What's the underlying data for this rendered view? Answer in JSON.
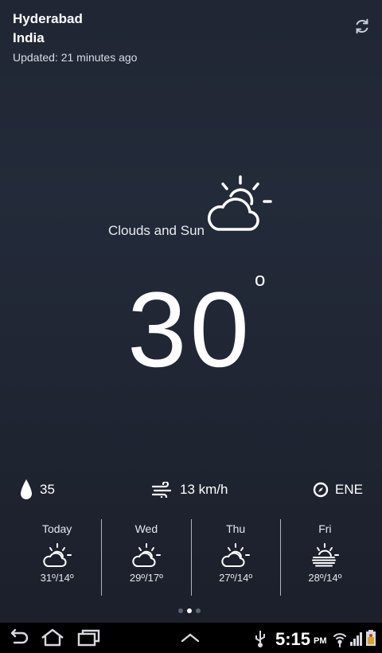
{
  "header": {
    "city": "Hyderabad",
    "country": "India",
    "updated": "Updated: 21 minutes ago"
  },
  "current": {
    "condition": "Clouds and Sun",
    "temperature": "30",
    "degree_symbol": "o"
  },
  "stats": {
    "humidity": "35",
    "wind": "13 km/h",
    "direction": "ENE"
  },
  "forecast": [
    {
      "day": "Today",
      "temps": "31º/14º"
    },
    {
      "day": "Wed",
      "temps": "29º/17º"
    },
    {
      "day": "Thu",
      "temps": "27º/14º"
    },
    {
      "day": "Fri",
      "temps": "28º/14º"
    }
  ],
  "status_bar": {
    "time": "5:15",
    "ampm": "PM"
  },
  "icons": {
    "refresh": "refresh-icon",
    "humidity": "drop-icon",
    "wind": "wind-icon",
    "direction": "compass-icon",
    "condition": "partly-cloudy-icon"
  }
}
